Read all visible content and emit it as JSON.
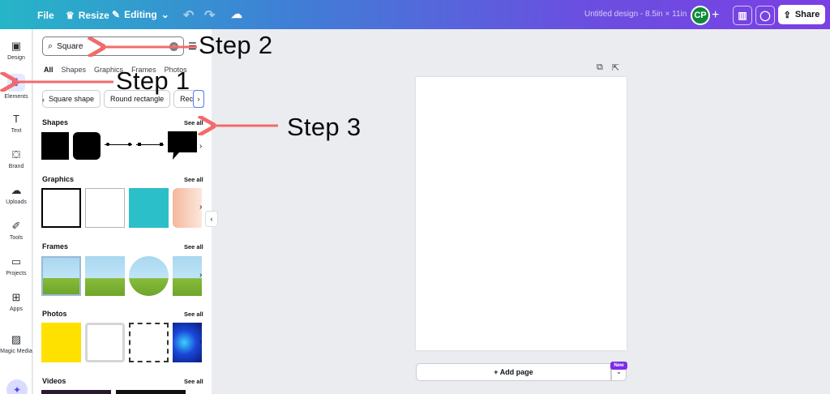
{
  "topbar": {
    "file_label": "File",
    "resize_label": "Resize",
    "editing_label": "Editing",
    "document_title": "Untitled design - 8.5in × 11in",
    "avatar_initials": "CP",
    "share_label": "Share",
    "gradient_start": "#26b5c8",
    "gradient_end": "#7b3fe4"
  },
  "rail": {
    "items": [
      {
        "label": "Design",
        "icon": "design-icon"
      },
      {
        "label": "Elements",
        "icon": "elements-icon"
      },
      {
        "label": "Text",
        "icon": "text-icon"
      },
      {
        "label": "Brand",
        "icon": "brand-icon"
      },
      {
        "label": "Uploads",
        "icon": "uploads-icon"
      },
      {
        "label": "Tools",
        "icon": "tools-icon"
      },
      {
        "label": "Projects",
        "icon": "projects-icon"
      },
      {
        "label": "Apps",
        "icon": "apps-icon"
      },
      {
        "label": "Magic Media",
        "icon": "magic-media-icon"
      }
    ],
    "active": "Elements"
  },
  "search": {
    "value": "Square"
  },
  "tabs": [
    "All",
    "Shapes",
    "Graphics",
    "Frames",
    "Photos"
  ],
  "chips": [
    "Square shape",
    "Round rectangle",
    "Recta"
  ],
  "sections": {
    "shapes": "Shapes",
    "graphics": "Graphics",
    "frames": "Frames",
    "photos": "Photos",
    "videos": "Videos",
    "see_all": "See all"
  },
  "canvas": {
    "add_page_label": "+ Add page",
    "new_badge": "New"
  },
  "annotations": {
    "step1": "Step 1",
    "step2": "Step 2",
    "step3": "Step 3",
    "arrow_color": "#f26b6b"
  }
}
